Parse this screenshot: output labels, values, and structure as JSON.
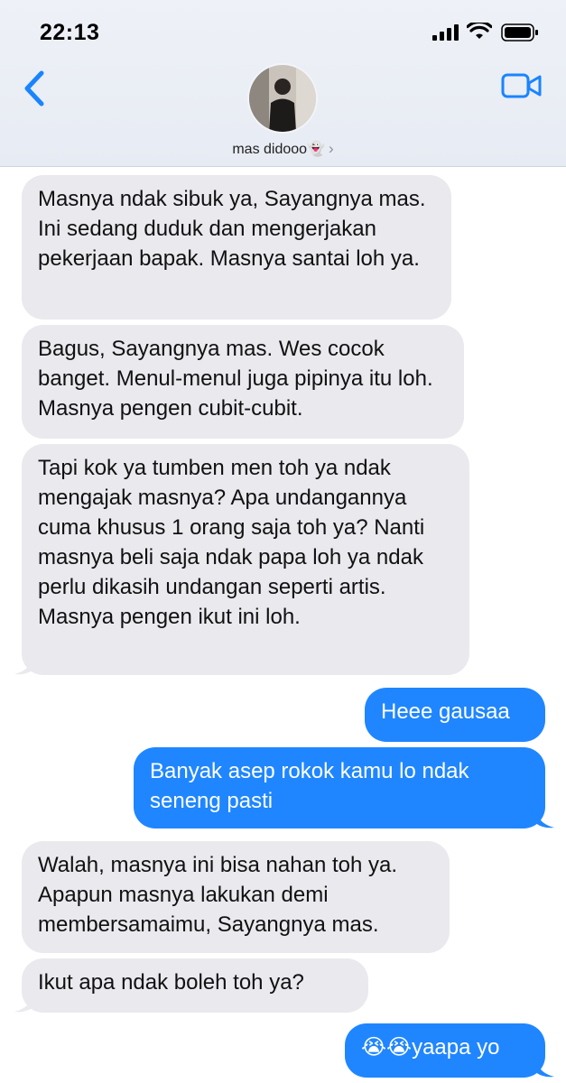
{
  "status_bar": {
    "time": "22:13"
  },
  "contact": {
    "name": "mas didooo👻",
    "chevron": "›"
  },
  "colors": {
    "incoming_bubble": "#e9e9ee",
    "outgoing_bubble": "#1f86ff",
    "accent": "#1a84ff"
  },
  "icons": [
    "back-chevron-icon",
    "video-camera-icon",
    "signal-icon",
    "wifi-icon",
    "battery-icon"
  ],
  "messages": [
    {
      "direction": "incoming",
      "text": "Masnya ndak sibuk ya, Sayangnya mas. Ini sedang duduk dan mengerjakan pekerjaan bapak. Masnya santai loh ya."
    },
    {
      "direction": "incoming",
      "text": "Bagus, Sayangnya mas. Wes cocok banget. Menul-menul juga pipinya itu loh. Masnya pengen cubit-cubit."
    },
    {
      "direction": "incoming",
      "text": "Tapi kok ya tumben men toh ya ndak mengajak masnya? Apa undangannya cuma khusus 1 orang saja toh ya? Nanti masnya beli saja ndak papa loh ya ndak perlu dikasih undangan seperti artis. Masnya pengen ikut ini loh."
    },
    {
      "direction": "outgoing",
      "text": "Heee gausaa"
    },
    {
      "direction": "outgoing",
      "text": "Banyak asep rokok kamu lo ndak seneng pasti"
    },
    {
      "direction": "incoming",
      "text": "Walah, masnya ini bisa nahan toh ya. Apapun masnya lakukan demi membersamaimu, Sayangnya mas."
    },
    {
      "direction": "incoming",
      "text": "Ikut apa ndak boleh toh ya?"
    },
    {
      "direction": "outgoing",
      "text": "😭😭yaapa yo"
    }
  ]
}
